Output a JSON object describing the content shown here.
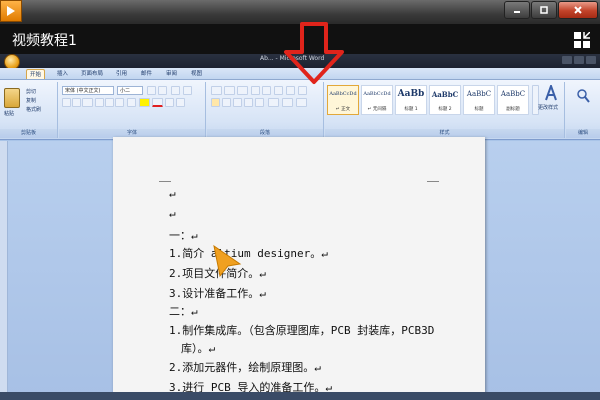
{
  "player": {
    "video_title": "视频教程1"
  },
  "office": {
    "window_title": "Ab... - Microsoft Word",
    "tabs": [
      "开始",
      "插入",
      "页面布局",
      "引用",
      "邮件",
      "审阅",
      "视图"
    ],
    "ribbon": {
      "clipboard": {
        "paste": "粘贴",
        "cut": "剪切",
        "copy": "复制",
        "format_painter": "格式刷",
        "label": "剪贴板"
      },
      "font": {
        "name": "宋体 (中文正文)",
        "size": "小二",
        "label": "字体"
      },
      "paragraph": {
        "label": "段落"
      },
      "styles": {
        "label": "样式",
        "items": [
          {
            "sample": "AaBbCcDd",
            "name": "↵ 正文"
          },
          {
            "sample": "AaBbCcDd",
            "name": "↵ 无间隔"
          },
          {
            "sample": "AaBb",
            "name": "标题 1"
          },
          {
            "sample": "AaBbC",
            "name": "标题 2"
          },
          {
            "sample": "AaBbC",
            "name": "标题"
          },
          {
            "sample": "AaBbC",
            "name": "副标题"
          }
        ],
        "change_styles": "更改样式"
      },
      "editing": {
        "label": "编辑"
      }
    }
  },
  "document": {
    "lines": [
      "↵",
      "↵",
      "一：↵",
      "1.简介 altium designer。↵",
      "2.项目文件简介。↵",
      "3.设计准备工作。↵",
      "二：↵",
      "1.制作集成库。（包含原理图库，PCB 封装库，PCB3D",
      "库）。↵",
      "2.添加元器件，绘制原理图。↵",
      "3.进行 PCB 导入的准备工作。↵"
    ]
  },
  "colors": {
    "arrow": "#e0241b",
    "cursor": "#f0a020"
  }
}
